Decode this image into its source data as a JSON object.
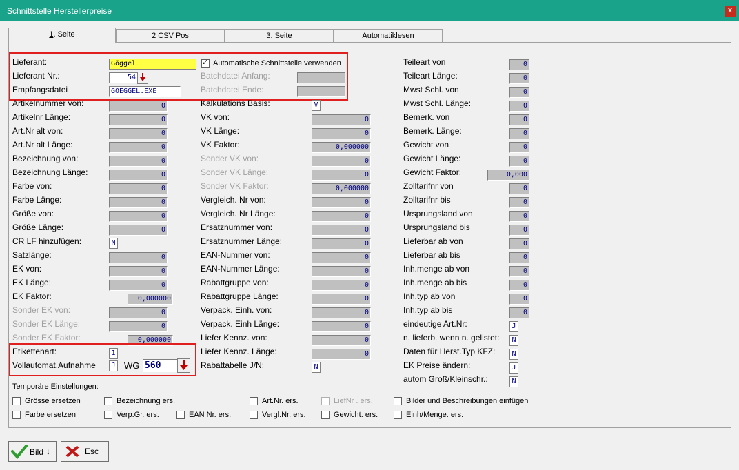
{
  "window": {
    "title": "Schnittstelle Herstellerpreise",
    "close_label": "x"
  },
  "tabs": [
    {
      "num": "1",
      "label": ". Seite"
    },
    {
      "num": "",
      "label": "2 CSV Pos"
    },
    {
      "num": "3",
      "label": ". Seite"
    },
    {
      "num": "",
      "label": "Automatiklesen"
    }
  ],
  "header": {
    "lieferant_label": "Lieferant:",
    "lieferant_value": "Göggel",
    "lieferant_nr_label": "Lieferant Nr.:",
    "lieferant_nr_value": "54",
    "empfangsdatei_label": "Empfangsdatei",
    "empfangsdatei_value": "GOEGGEL.EXE",
    "auto_schnittstelle_label": "Automatische Schnittstelle verwenden",
    "batch_anfang_label": "Batchdatei Anfang:",
    "batch_ende_label": "Batchdatei Ende:"
  },
  "col1": [
    {
      "label": "Artikelnummer von:",
      "value": "0"
    },
    {
      "label": "Artikelnr Länge:",
      "value": "0"
    },
    {
      "label": "Art.Nr alt von:",
      "value": "0"
    },
    {
      "label": "Art.Nr alt Länge:",
      "value": "0"
    },
    {
      "label": "Bezeichnung   von:",
      "value": "0"
    },
    {
      "label": "Bezeichnung Länge:",
      "value": "0"
    },
    {
      "label": "Farbe von:",
      "value": "0"
    },
    {
      "label": "Farbe Länge:",
      "value": "0"
    },
    {
      "label": "Größe von:",
      "value": "0"
    },
    {
      "label": "Größe Länge:",
      "value": "0"
    },
    {
      "label": "CR LF hinzufügen:",
      "value": "N"
    },
    {
      "label": "Satzlänge:",
      "value": "0"
    },
    {
      "label": "EK von:",
      "value": "0"
    },
    {
      "label": "EK Länge:",
      "value": "0"
    },
    {
      "label": "EK Faktor:",
      "value": "0,000000"
    },
    {
      "label": "Sonder EK von:",
      "value": "0"
    },
    {
      "label": "Sonder EK Länge:",
      "value": "0"
    },
    {
      "label": "Sonder EK Faktor:",
      "value": "0,000000"
    }
  ],
  "etikett": {
    "etikettenart_label": "Etikettenart:",
    "etikettenart_value": "1",
    "vollautomat_label": "Vollautomat.Aufnahme",
    "vollautomat_value": "J",
    "wg_label": "WG",
    "wg_value": "560"
  },
  "col2": [
    {
      "label": "Kalkulations Basis:",
      "value": "V"
    },
    {
      "label": "VK von:",
      "value": "0"
    },
    {
      "label": "VK Länge:",
      "value": "0"
    },
    {
      "label": "VK Faktor:",
      "value": "0,000000"
    },
    {
      "label": "Sonder VK von:",
      "value": "0"
    },
    {
      "label": "Sonder VK Länge:",
      "value": "0"
    },
    {
      "label": "Sonder VK Faktor:",
      "value": "0,000000"
    },
    {
      "label": "Vergleich. Nr von:",
      "value": "0"
    },
    {
      "label": "Vergleich. Nr Länge:",
      "value": "0"
    },
    {
      "label": "Ersatznummer  von:",
      "value": "0"
    },
    {
      "label": "Ersatznummer Länge:",
      "value": "0"
    },
    {
      "label": "EAN-Nummer     von:",
      "value": "0"
    },
    {
      "label": "EAN-Nummer   Länge:",
      "value": "0"
    },
    {
      "label": "Rabattgruppe  von:",
      "value": "0"
    },
    {
      "label": "Rabattgruppe  Länge:",
      "value": "0"
    },
    {
      "label": "Verpack. Einh. von:",
      "value": "0"
    },
    {
      "label": "Verpack. Einh Länge:",
      "value": "0"
    },
    {
      "label": "Liefer Kennz.  von:",
      "value": "0"
    },
    {
      "label": "Liefer Kennz.  Länge:",
      "value": "0"
    },
    {
      "label": "Rabattabelle J/N:",
      "value": "N"
    }
  ],
  "col3": [
    {
      "label": "Teileart von",
      "value": "0"
    },
    {
      "label": "Teileart Länge:",
      "value": "0"
    },
    {
      "label": "Mwst Schl. von",
      "value": "0"
    },
    {
      "label": "Mwst Schl. Länge:",
      "value": "0"
    },
    {
      "label": "Bemerk. von",
      "value": "0"
    },
    {
      "label": "Bemerk. Länge:",
      "value": "0"
    },
    {
      "label": "Gewicht von",
      "value": "0"
    },
    {
      "label": "Gewicht Länge:",
      "value": "0"
    },
    {
      "label": "Gewicht Faktor:",
      "value": "0,000"
    },
    {
      "label": "Zolltarifnr von",
      "value": "0"
    },
    {
      "label": "Zolltarifnr bis",
      "value": "0"
    },
    {
      "label": "Ursprungsland von",
      "value": "0"
    },
    {
      "label": "Ursprungsland bis",
      "value": "0"
    },
    {
      "label": "Lieferbar ab von",
      "value": "0"
    },
    {
      "label": "Lieferbar ab bis",
      "value": "0"
    },
    {
      "label": "Inh.menge ab von",
      "value": "0"
    },
    {
      "label": "Inh.menge ab bis",
      "value": "0"
    },
    {
      "label": "Inh.typ ab von",
      "value": "0"
    },
    {
      "label": "Inh.typ ab bis",
      "value": "0"
    },
    {
      "label": "eindeutige Art.Nr:",
      "value": "J"
    },
    {
      "label": "n. lieferb. wenn n. gelistet:",
      "value": "N"
    },
    {
      "label": "Daten für Herst.Typ KFZ:",
      "value": "N"
    },
    {
      "label": "EK Preise ändern:",
      "value": "J"
    },
    {
      "label": "autom Groß/Kleinschr.:",
      "value": "N"
    }
  ],
  "temp": {
    "title": "Temporäre Einstellungen:",
    "row1": [
      "Grösse ersetzen",
      "Bezeichnung ers.",
      "Art.Nr. ers.",
      "LiefNr  . ers.",
      "Bilder und Beschreibungen einfügen"
    ],
    "row2": [
      "Farbe ersetzen",
      "Verp.Gr. ers.",
      "EAN Nr. ers.",
      "Vergl.Nr. ers.",
      "Gewicht. ers.",
      "Einh/Menge. ers."
    ]
  },
  "buttons": {
    "bild_label": "Bild",
    "esc_label": "Esc"
  },
  "colors": {
    "titlebar": "#19a38a",
    "highlight": "#e02020",
    "lieferant_bg": "#ffff44"
  }
}
